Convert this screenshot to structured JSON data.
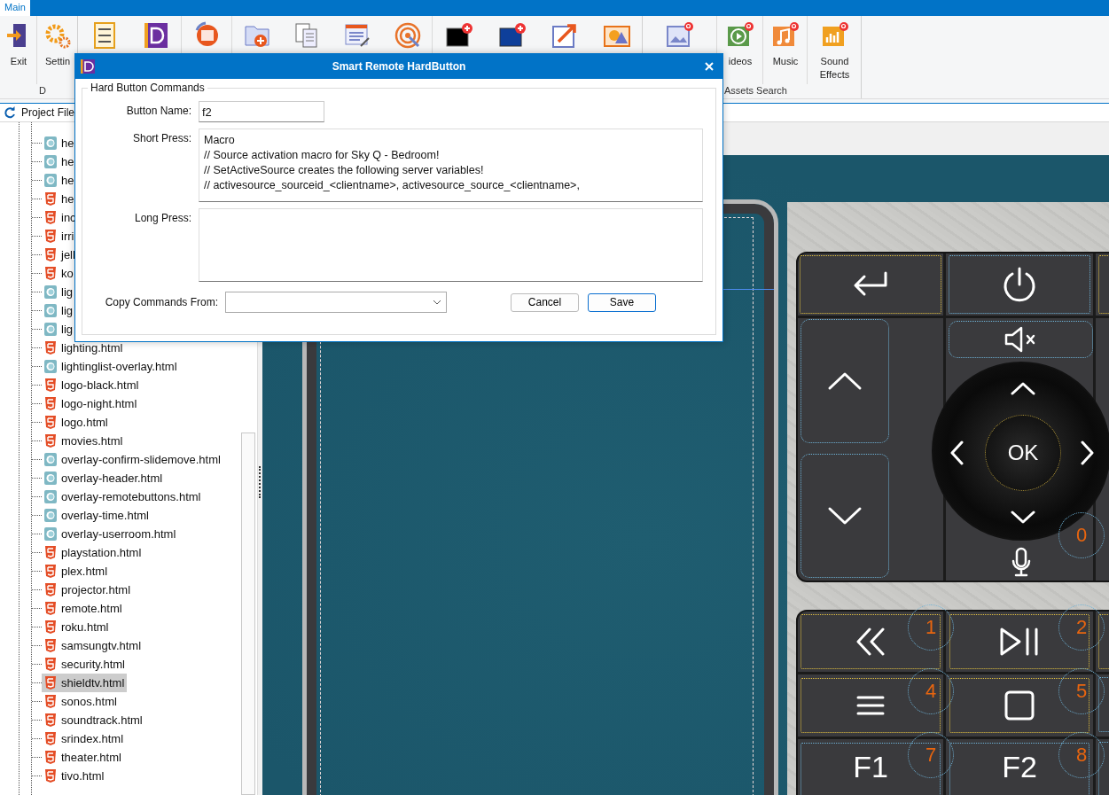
{
  "ribbon": {
    "tab": {
      "label": "Main",
      "selected": true
    },
    "groups": [
      {
        "label": "D",
        "sections": [
          [
            {
              "kind": "exit",
              "label": "Exit"
            }
          ],
          [
            {
              "kind": "settings",
              "label": "Settin"
            }
          ]
        ]
      },
      {
        "sections": [
          [
            {
              "kind": "checklist"
            },
            {
              "kind": "logo"
            }
          ],
          [
            {
              "kind": "convert"
            }
          ],
          [
            {
              "kind": "folder-add"
            },
            {
              "kind": "documents"
            },
            {
              "kind": "list-edit"
            },
            {
              "kind": "target"
            }
          ],
          [
            {
              "kind": "screen-add"
            },
            {
              "kind": "blue-screen-add"
            },
            {
              "kind": "arrow-out"
            },
            {
              "kind": "shapes"
            }
          ]
        ]
      },
      {
        "label": "Assets Search",
        "sections": [
          [
            {
              "kind": "image-search"
            }
          ],
          [
            {
              "kind": "video-search",
              "label": "ideos"
            }
          ],
          [
            {
              "kind": "music-search",
              "label": "Music"
            }
          ],
          [
            {
              "kind": "sound-search",
              "label": "Sound Effects"
            }
          ]
        ]
      }
    ]
  },
  "project_files": {
    "title": "Project File",
    "files": [
      {
        "name": "he",
        "kind": "overlay",
        "selected": false
      },
      {
        "name": "he",
        "kind": "overlay",
        "selected": false
      },
      {
        "name": "he",
        "kind": "overlay",
        "selected": false
      },
      {
        "name": "he",
        "kind": "html5",
        "selected": false
      },
      {
        "name": "inc",
        "kind": "html5",
        "selected": false
      },
      {
        "name": "irri",
        "kind": "html5",
        "selected": false
      },
      {
        "name": "jell",
        "kind": "html5",
        "selected": false
      },
      {
        "name": "ko",
        "kind": "html5",
        "selected": false
      },
      {
        "name": "lig",
        "kind": "overlay",
        "selected": false
      },
      {
        "name": "lig",
        "kind": "overlay",
        "selected": false
      },
      {
        "name": "lig",
        "kind": "overlay",
        "selected": false
      },
      {
        "name": "lighting.html",
        "kind": "html5",
        "selected": false
      },
      {
        "name": "lightinglist-overlay.html",
        "kind": "overlay",
        "selected": false
      },
      {
        "name": "logo-black.html",
        "kind": "html5",
        "selected": false
      },
      {
        "name": "logo-night.html",
        "kind": "html5",
        "selected": false
      },
      {
        "name": "logo.html",
        "kind": "html5",
        "selected": false
      },
      {
        "name": "movies.html",
        "kind": "html5",
        "selected": false
      },
      {
        "name": "overlay-confirm-slidemove.html",
        "kind": "overlay",
        "selected": false
      },
      {
        "name": "overlay-header.html",
        "kind": "overlay",
        "selected": false
      },
      {
        "name": "overlay-remotebuttons.html",
        "kind": "overlay",
        "selected": false
      },
      {
        "name": "overlay-time.html",
        "kind": "overlay",
        "selected": false
      },
      {
        "name": "overlay-userroom.html",
        "kind": "overlay",
        "selected": false
      },
      {
        "name": "playstation.html",
        "kind": "html5",
        "selected": false
      },
      {
        "name": "plex.html",
        "kind": "html5",
        "selected": false
      },
      {
        "name": "projector.html",
        "kind": "html5",
        "selected": false
      },
      {
        "name": "remote.html",
        "kind": "html5",
        "selected": false
      },
      {
        "name": "roku.html",
        "kind": "html5",
        "selected": false
      },
      {
        "name": "samsungtv.html",
        "kind": "html5",
        "selected": false
      },
      {
        "name": "security.html",
        "kind": "html5",
        "selected": false
      },
      {
        "name": "shieldtv.html",
        "kind": "html5",
        "selected": true
      },
      {
        "name": "sonos.html",
        "kind": "html5",
        "selected": false
      },
      {
        "name": "soundtrack.html",
        "kind": "html5",
        "selected": false
      },
      {
        "name": "srindex.html",
        "kind": "html5",
        "selected": false
      },
      {
        "name": "theater.html",
        "kind": "html5",
        "selected": false
      },
      {
        "name": "tivo.html",
        "kind": "html5",
        "selected": false
      }
    ]
  },
  "remote": {
    "ok_label": "OK",
    "mic_badge": "0",
    "keys": [
      {
        "kind": "rewind",
        "badge": "1"
      },
      {
        "kind": "play-pause",
        "badge": "2"
      },
      {
        "kind": "menu",
        "badge": "4"
      },
      {
        "kind": "stop",
        "badge": "5"
      },
      {
        "kind": "text",
        "label": "F1",
        "badge": "7"
      },
      {
        "kind": "text",
        "label": "F2",
        "badge": "8"
      }
    ]
  },
  "dialog": {
    "title": "Smart Remote HardButton",
    "group_title": "Hard Button Commands",
    "button_name": {
      "label": "Button Name:",
      "value": "f2"
    },
    "short_press": {
      "label": "Short Press:",
      "lines": [
        "Macro",
        "// Source activation macro for Sky Q - Bedroom!",
        "// SetActiveSource creates the following server variables!",
        "// activesource_sourceid_<clientname>, activesource_source_<clientname>,"
      ]
    },
    "long_press": {
      "label": "Long Press:"
    },
    "copy_from": {
      "label": "Copy Commands From:"
    },
    "buttons": [
      {
        "label": "Cancel",
        "default": false
      },
      {
        "label": "Save",
        "default": true
      }
    ]
  }
}
